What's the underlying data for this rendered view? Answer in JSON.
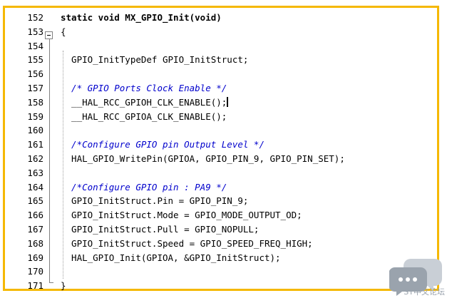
{
  "editor": {
    "lines": [
      {
        "num": "152",
        "text": "static void MX_GPIO_Init(void)",
        "style": "kw"
      },
      {
        "num": "153",
        "text": "{",
        "style": ""
      },
      {
        "num": "154",
        "text": "",
        "style": ""
      },
      {
        "num": "155",
        "text": "  GPIO_InitTypeDef GPIO_InitStruct;",
        "style": ""
      },
      {
        "num": "156",
        "text": "",
        "style": ""
      },
      {
        "num": "157",
        "text": "  /* GPIO Ports Clock Enable */",
        "style": "cm"
      },
      {
        "num": "158",
        "text": "  __HAL_RCC_GPIOH_CLK_ENABLE();",
        "style": ""
      },
      {
        "num": "159",
        "text": "  __HAL_RCC_GPIOA_CLK_ENABLE();",
        "style": ""
      },
      {
        "num": "160",
        "text": "",
        "style": ""
      },
      {
        "num": "161",
        "text": "  /*Configure GPIO pin Output Level */",
        "style": "cm"
      },
      {
        "num": "162",
        "text": "  HAL_GPIO_WritePin(GPIOA, GPIO_PIN_9, GPIO_PIN_SET);",
        "style": ""
      },
      {
        "num": "163",
        "text": "",
        "style": ""
      },
      {
        "num": "164",
        "text": "  /*Configure GPIO pin : PA9 */",
        "style": "cm"
      },
      {
        "num": "165",
        "text": "  GPIO_InitStruct.Pin = GPIO_PIN_9;",
        "style": ""
      },
      {
        "num": "166",
        "text": "  GPIO_InitStruct.Mode = GPIO_MODE_OUTPUT_OD;",
        "style": ""
      },
      {
        "num": "167",
        "text": "  GPIO_InitStruct.Pull = GPIO_NOPULL;",
        "style": ""
      },
      {
        "num": "168",
        "text": "  GPIO_InitStruct.Speed = GPIO_SPEED_FREQ_HIGH;",
        "style": ""
      },
      {
        "num": "169",
        "text": "  HAL_GPIO_Init(GPIOA, &GPIO_InitStruct);",
        "style": ""
      },
      {
        "num": "170",
        "text": "",
        "style": ""
      },
      {
        "num": "171",
        "text": "}",
        "style": ""
      }
    ],
    "caret_line": "158"
  },
  "watermark": {
    "text": "ST中文论坛",
    "icon": "chat-bubbles-icon"
  },
  "colors": {
    "frame_border": "#f5b800",
    "comment": "#0000cc"
  }
}
